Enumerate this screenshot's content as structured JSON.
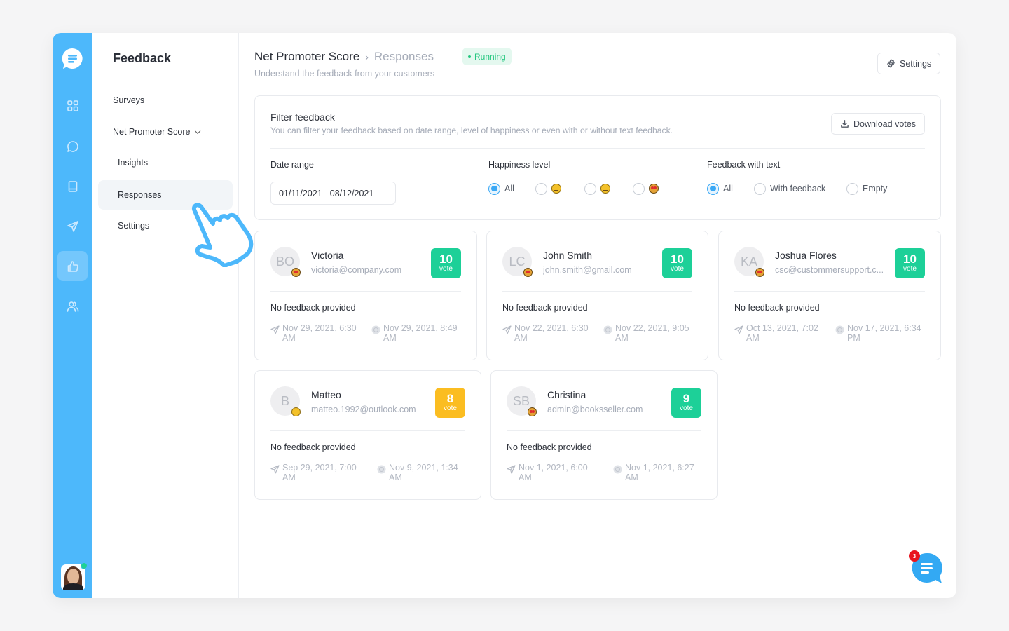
{
  "app": {
    "rail": {
      "items": [
        {
          "icon": "dashboard-icon"
        },
        {
          "icon": "chat-icon"
        },
        {
          "icon": "book-icon"
        },
        {
          "icon": "send-icon"
        },
        {
          "icon": "thumbs-up-icon",
          "active": true
        },
        {
          "icon": "users-icon"
        }
      ]
    },
    "sidebar": {
      "title": "Feedback",
      "items": [
        {
          "label": "Surveys"
        },
        {
          "label": "Net Promoter Score",
          "expanded": true
        },
        {
          "label": "Insights"
        },
        {
          "label": "Responses",
          "active": true
        },
        {
          "label": "Settings"
        }
      ]
    },
    "header": {
      "breadcrumb_parent": "Net Promoter Score",
      "breadcrumb_separator": "›",
      "breadcrumb_current": "Responses",
      "status": "Running",
      "subtitle": "Understand the feedback from your customers",
      "settings_label": "Settings"
    },
    "filter": {
      "title": "Filter feedback",
      "description": "You can filter your feedback based on date range, level of happiness or even with or without text feedback.",
      "download_label": "Download votes",
      "date_range_label": "Date range",
      "date_range_value": "01/11/2021 - 08/12/2021",
      "happiness_label": "Happiness level",
      "happiness_options": [
        {
          "label": "All",
          "checked": true
        },
        {
          "emoji": "unamused-face",
          "checked": false
        },
        {
          "emoji": "neutral-face",
          "checked": false
        },
        {
          "emoji": "heart-eyes-face",
          "checked": false
        }
      ],
      "text_label": "Feedback with text",
      "text_options": [
        {
          "label": "All",
          "checked": true
        },
        {
          "label": "With feedback",
          "checked": false
        },
        {
          "label": "Empty",
          "checked": false
        }
      ]
    },
    "responses": [
      {
        "initials": "BO",
        "name": "Victoria",
        "email": "victoria@company.com",
        "score": "10",
        "vote_label": "vote",
        "mood": "heart-eyes",
        "color": "#1dd098",
        "feedback": "No feedback provided",
        "sent": "Nov 29, 2021, 6:30 AM",
        "answered": "Nov 29, 2021, 8:49 AM"
      },
      {
        "initials": "LC",
        "name": "John Smith",
        "email": "john.smith@gmail.com",
        "score": "10",
        "vote_label": "vote",
        "mood": "heart-eyes",
        "color": "#1dd098",
        "feedback": "No feedback provided",
        "sent": "Nov 22, 2021, 6:30 AM",
        "answered": "Nov 22, 2021, 9:05 AM"
      },
      {
        "initials": "KA",
        "name": "Joshua Flores",
        "email": "csc@custommersupport.c...",
        "score": "10",
        "vote_label": "vote",
        "mood": "heart-eyes",
        "color": "#1dd098",
        "feedback": "No feedback provided",
        "sent": "Oct 13, 2021, 7:02 AM",
        "answered": "Nov 17, 2021, 6:34 PM"
      },
      {
        "initials": "B",
        "name": "Matteo",
        "email": "matteo.1992@outlook.com",
        "score": "8",
        "vote_label": "vote",
        "mood": "neutral",
        "color": "#fbbd21",
        "feedback": "No feedback provided",
        "sent": "Sep 29, 2021, 7:00 AM",
        "answered": "Nov 9, 2021, 1:34 AM"
      },
      {
        "initials": "SB",
        "name": "Christina",
        "email": "admin@booksseller.com",
        "score": "9",
        "vote_label": "vote",
        "mood": "heart-eyes",
        "color": "#1dd098",
        "feedback": "No feedback provided",
        "sent": "Nov 1, 2021, 6:00 AM",
        "answered": "Nov 1, 2021, 6:27 AM"
      }
    ],
    "chat": {
      "unread_count": "3"
    },
    "colors": {
      "primary": "#4db8fb",
      "promoter": "#1dd098",
      "passive": "#fbbd21",
      "status_running": "#24c77f"
    }
  }
}
